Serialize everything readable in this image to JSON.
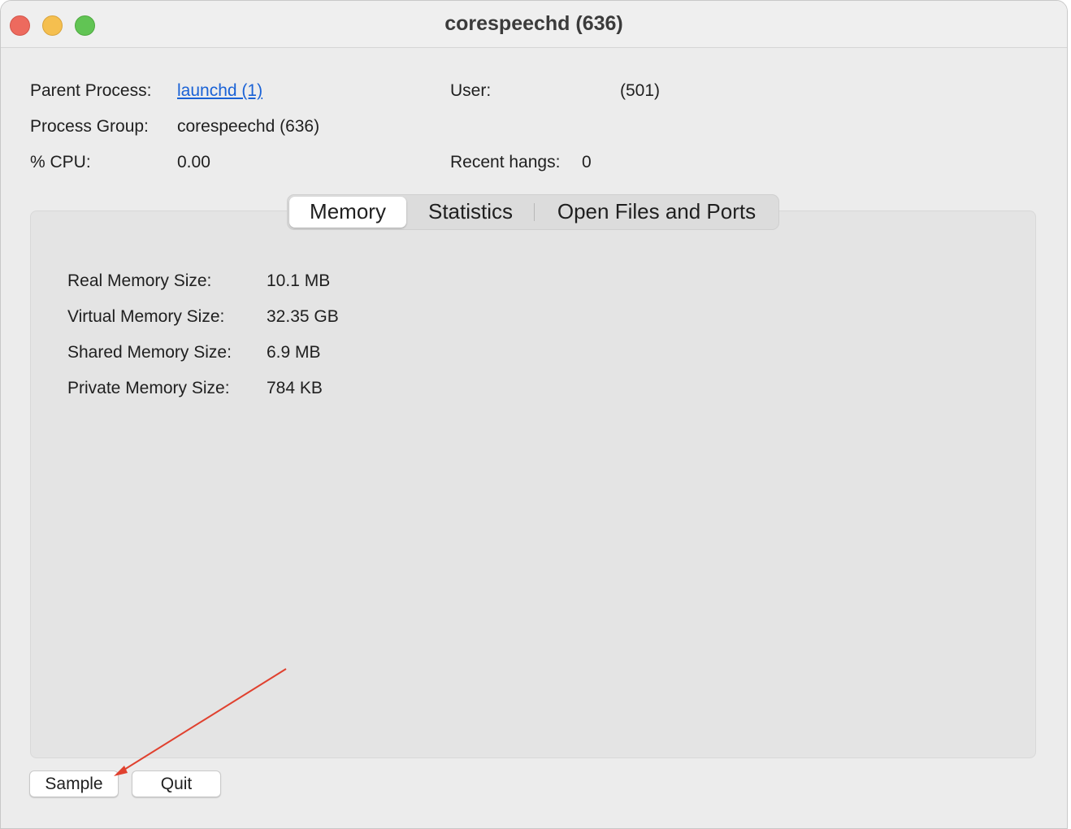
{
  "window": {
    "title": "corespeechd (636)"
  },
  "info": {
    "parent_process_label": "Parent Process:",
    "parent_process_value": "launchd (1)",
    "process_group_label": "Process Group:",
    "process_group_value": "corespeechd (636)",
    "cpu_label": "% CPU:",
    "cpu_value": "0.00",
    "user_label": "User:",
    "user_value": "(501)",
    "recent_hangs_label": "Recent hangs:",
    "recent_hangs_value": "0"
  },
  "tabs": [
    {
      "label": "Memory",
      "selected": true
    },
    {
      "label": "Statistics",
      "selected": false
    },
    {
      "label": "Open Files and Ports",
      "selected": false
    }
  ],
  "memory": [
    {
      "label": "Real Memory Size:",
      "value": "10.1 MB"
    },
    {
      "label": "Virtual Memory Size:",
      "value": "32.35 GB"
    },
    {
      "label": "Shared Memory Size:",
      "value": "6.9 MB"
    },
    {
      "label": "Private Memory Size:",
      "value": "784 KB"
    }
  ],
  "buttons": {
    "sample": "Sample",
    "quit": "Quit"
  },
  "colors": {
    "link": "#1a62d6",
    "annotation_arrow": "#e0412f",
    "close": "#ed6a5e",
    "minimize": "#f5bf4f",
    "zoom": "#61c454"
  }
}
